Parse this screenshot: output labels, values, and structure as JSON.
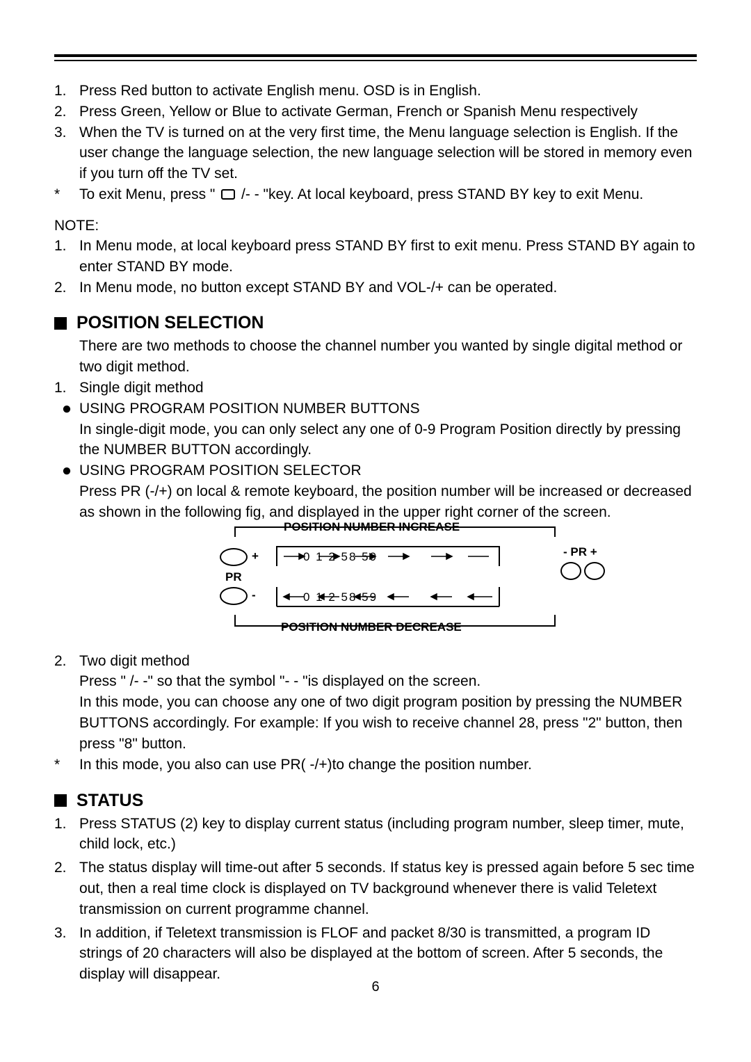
{
  "list1": {
    "n1": "1.",
    "t1": "Press Red button to activate English menu. OSD is in English.",
    "n2": "2.",
    "t2": "Press Green, Yellow or Blue to activate German, French or Spanish Menu respectively",
    "n3": "3.",
    "t3": "When the TV is turned on at the very first time, the Menu language selection is English. If the user change the language selection, the new language selection will be stored in memory even if you turn off the TV set.",
    "star": "*",
    "t4a": "To exit Menu, press \" ",
    "t4b": " /- - \"key. At local keyboard, press STAND BY key to exit Menu."
  },
  "noteLabel": "NOTE:",
  "note": {
    "n1": "1.",
    "t1": "In Menu mode, at local keyboard press STAND BY first to exit menu. Press STAND BY again to enter STAND BY mode.",
    "n2": "2.",
    "t2": "In Menu mode, no button except STAND BY and VOL-/+  can be operated."
  },
  "sec1": {
    "title": "POSITION SELECTION",
    "intro": "There are two methods to choose the channel number you wanted by single digital method or two digit method.",
    "n1": "1.",
    "t1": "Single digit method",
    "b1t": "USING PROGRAM POSITION NUMBER BUTTONS",
    "b1d": "In single-digit mode, you can only select any one of 0-9 Program Position directly by pressing the NUMBER BUTTON accordingly.",
    "b2t": "USING PROGRAM POSITION SELECTOR",
    "b2d": "Press PR (-/+) on local & remote keyboard, the position number will be increased or decreased as shown in the following fig, and displayed in the upper right corner of the screen.",
    "n2": "2.",
    "t2": "Two digit method",
    "t2a": "Press \"       /- -\" so that the symbol \"- - \"is displayed on the screen.",
    "t2b": "In this mode, you can choose any one of two digit program position by pressing the NUMBER BUTTONS accordingly. For example: If you wish to receive channel 28, press \"2\" button, then press \"8\" button.",
    "star": "*",
    "t2c": "In this mode, you also can use PR( -/+)to change the position number."
  },
  "diagram": {
    "inc": "POSITION NUMBER INCREASE",
    "dec": "POSITION NUMBER DECREASE",
    "seqInc": "0    1     2         58    59",
    "seqDec": "0    1     2         58    59",
    "pr": "PR",
    "plus": "+",
    "minus": "-",
    "prpm": "- PR +"
  },
  "sec2": {
    "title": "STATUS",
    "n1": "1.",
    "t1": "Press STATUS (2) key to display current status (including program number, sleep timer, mute, child lock, etc.)",
    "n2": "2.",
    "t2": "The status display will time-out after 5 seconds. If status key is pressed again before 5 sec time out, then a real time clock is displayed on TV background whenever there is valid Teletext transmission on current programme channel.",
    "n3": "3.",
    "t3": "In addition, if Teletext transmission is FLOF and packet 8/30 is transmitted, a program ID strings of 20 characters will also be displayed at the bottom of screen. After 5 seconds, the display will disappear."
  },
  "pageNumber": "6"
}
